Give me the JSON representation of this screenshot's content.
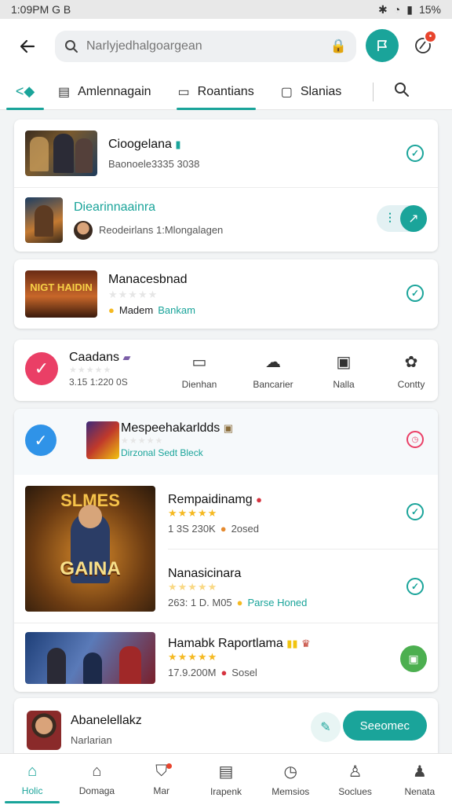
{
  "status_bar": {
    "time": "1:09PM G B",
    "battery": "15%"
  },
  "search": {
    "placeholder": "Narlyjedhalgoargean"
  },
  "tabs": [
    {
      "label": "Amlennagain"
    },
    {
      "label": "Roantians"
    },
    {
      "label": "Slanias"
    }
  ],
  "list1": [
    {
      "title": "Cioogelana",
      "subtitle": "Baonoele3335 3038"
    },
    {
      "title": "Diearinnaainra",
      "subtitle": "Reodeirlans 1:Mlongalagen"
    }
  ],
  "item2": {
    "title": "Manacesbnad",
    "meta": "Madem",
    "meta_link": "Bankam",
    "thumb_text": "NIGT HAIDIN"
  },
  "quick": {
    "title": "Caadans",
    "subtitle": "3.15 1:220 0S",
    "actions": [
      {
        "label": "Dienhan"
      },
      {
        "label": "Bancarier"
      },
      {
        "label": "Nalla"
      },
      {
        "label": "Contty"
      }
    ]
  },
  "featured": {
    "header": {
      "title": "Mespeehakarldds",
      "subtitle": "Dirzonal Sedt Bleck"
    },
    "cover_text": {
      "top": "SLMES",
      "mid": "GAINA"
    },
    "items": [
      {
        "title": "Rempaidinamg",
        "stats": "1 3S 230K",
        "extra": "2osed"
      },
      {
        "title": "Nanasicinara",
        "stats": "263: 1 D. M05",
        "extra": "Parse Honed"
      },
      {
        "title": "Hamabk Raportlama",
        "stats": "17.9.200M",
        "extra": "Sosel"
      }
    ]
  },
  "bottom_card": {
    "title": "Abanelellakz",
    "subtitle": "Narlarian",
    "button": "Seeomec"
  },
  "nav": [
    {
      "label": "Holic"
    },
    {
      "label": "Domaga"
    },
    {
      "label": "Mar"
    },
    {
      "label": "Irapenk"
    },
    {
      "label": "Memsios"
    },
    {
      "label": "Soclues"
    },
    {
      "label": "Nenata"
    }
  ],
  "colors": {
    "accent": "#1aa49a",
    "check_pink": "#ea3f66",
    "check_blue": "#2f93e8",
    "stars": "#f5b921"
  }
}
